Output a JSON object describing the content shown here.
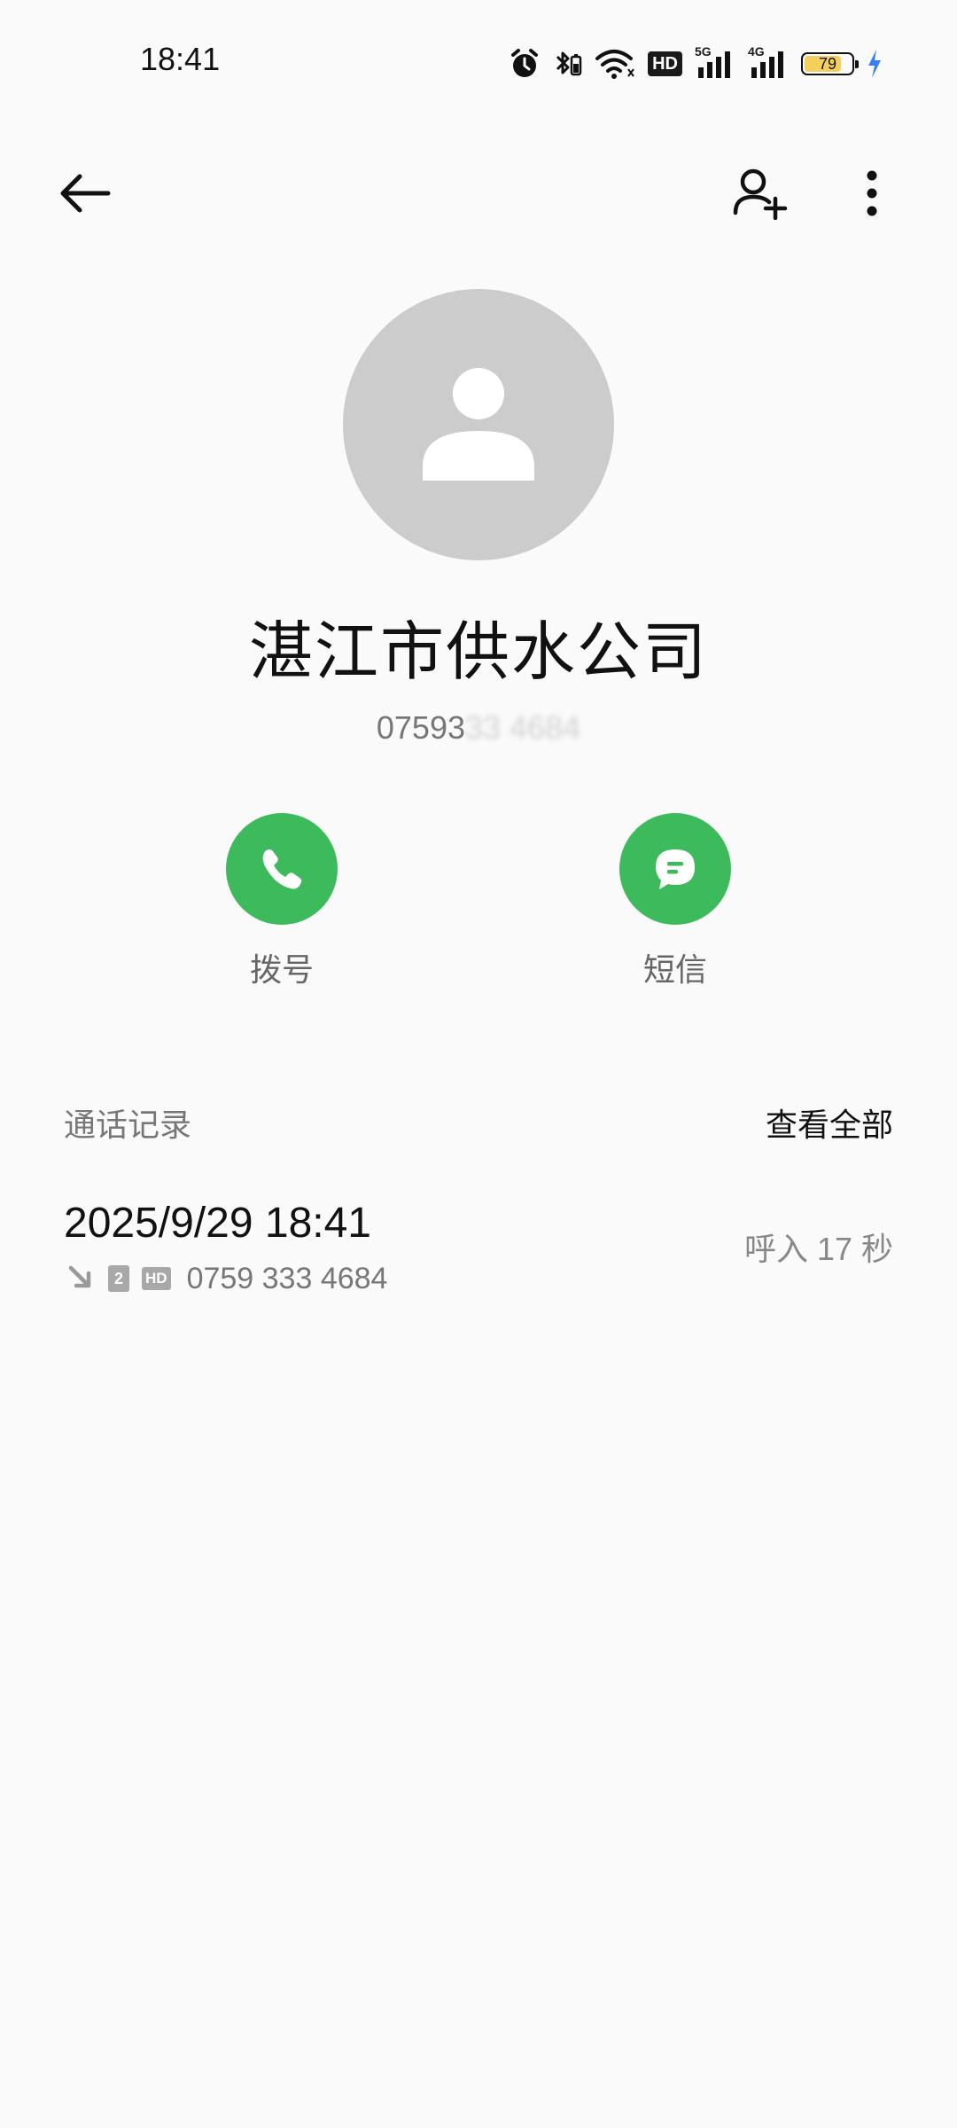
{
  "status_bar": {
    "time": "18:41",
    "hd_label": "HD",
    "net1": "5G",
    "net2": "4G",
    "battery": "79",
    "battery_level": 0.79,
    "icons": [
      "alarm-icon",
      "bluetooth-icon",
      "wifi-icon",
      "hd-voice-icon",
      "signal-icon",
      "signal-icon",
      "battery-icon",
      "charging-icon"
    ]
  },
  "toolbar": {
    "back_icon": "arrow-left-icon",
    "add_contact_icon": "person-add-icon",
    "more_icon": "more-vertical-icon"
  },
  "contact": {
    "name": "湛江市供水公司",
    "number_visible": "07593",
    "number_obscured": "33 4684",
    "avatar_icon": "person-icon"
  },
  "actions": {
    "call_label": "拨号",
    "sms_label": "短信"
  },
  "call_log": {
    "title": "通话记录",
    "view_all": "查看全部",
    "entries": [
      {
        "datetime": "2025/9/29 18:41",
        "sim": "2",
        "hd": "HD",
        "number": "0759 333 4684",
        "type": "呼入  17 秒",
        "direction_icon": "incoming-arrow-icon"
      }
    ]
  },
  "colors": {
    "accent_green": "#3dbb5c",
    "avatar_bg": "#cccccc",
    "background": "#fafafa",
    "battery_fill": "#f5cf5c",
    "charging": "#3b7ff5"
  }
}
